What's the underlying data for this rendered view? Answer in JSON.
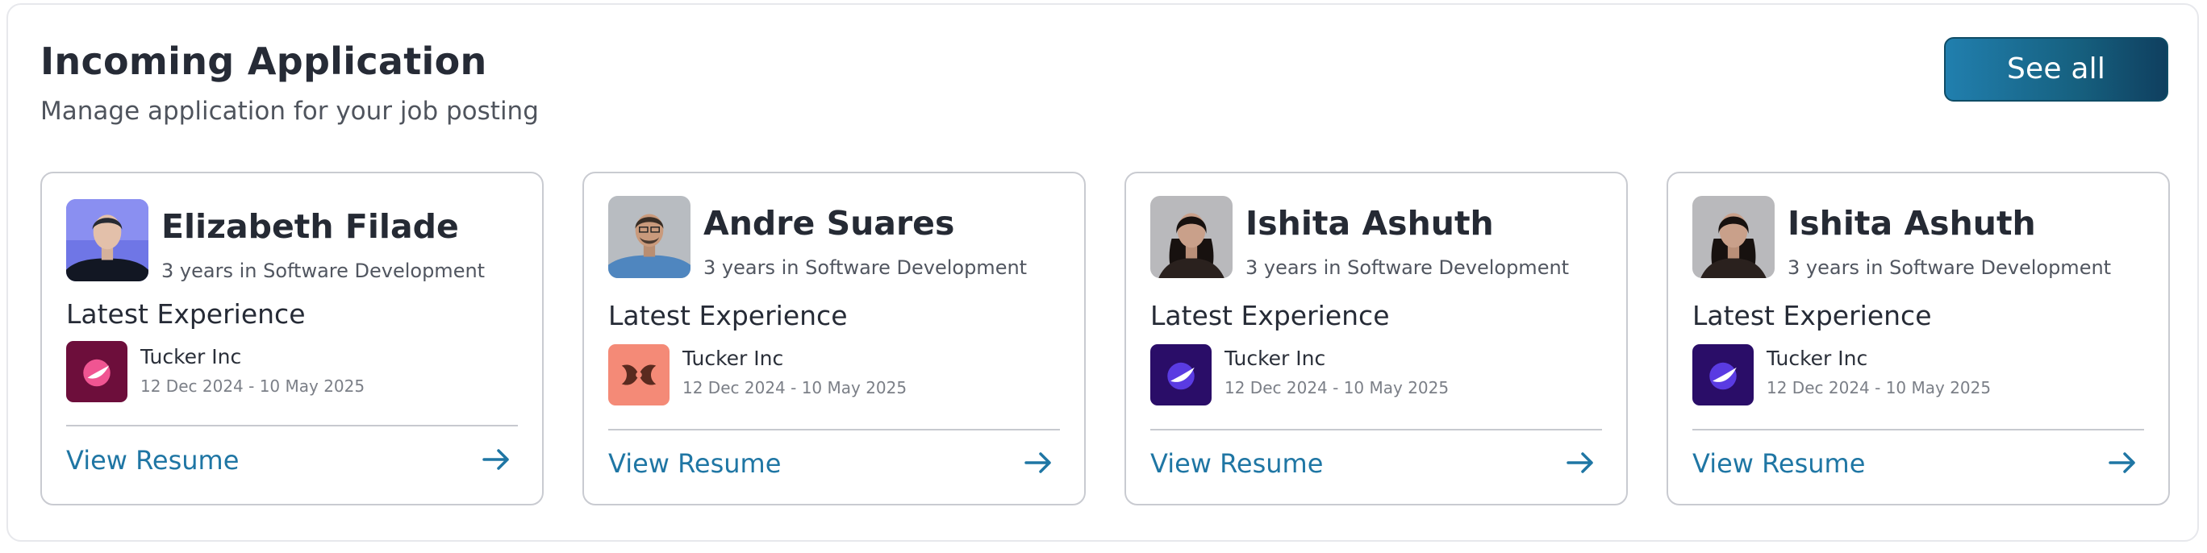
{
  "header": {
    "title": "Incoming Application",
    "subtitle": "Manage application for your job posting",
    "see_all_label": "See all"
  },
  "cards": [
    {
      "name": "Elizabeth Filade",
      "experience": "3 years in Software Development",
      "latest_label": "Latest Experience",
      "company": "Tucker Inc",
      "dates": "12 Dec 2024 - 10 May 2025",
      "action": "View Resume",
      "avatar_icon": "avatar-woman-blue-bg",
      "company_icon": "tucker-logo-pink"
    },
    {
      "name": "Andre Suares",
      "experience": "3 years in Software Development",
      "latest_label": "Latest Experience",
      "company": "Tucker Inc",
      "dates": "12 Dec 2024 - 10 May 2025",
      "action": "View Resume",
      "avatar_icon": "avatar-man-grey-bg",
      "company_icon": "tucker-logo-coral"
    },
    {
      "name": "Ishita Ashuth",
      "experience": "3 years in Software Development",
      "latest_label": "Latest Experience",
      "company": "Tucker Inc",
      "dates": "12 Dec 2024 - 10 May 2025",
      "action": "View Resume",
      "avatar_icon": "avatar-woman-grey-bg",
      "company_icon": "tucker-logo-indigo"
    },
    {
      "name": "Ishita Ashuth",
      "experience": "3 years in Software Development",
      "latest_label": "Latest Experience",
      "company": "Tucker Inc",
      "dates": "12 Dec 2024 - 10 May 2025",
      "action": "View Resume",
      "avatar_icon": "avatar-woman-grey-bg",
      "company_icon": "tucker-logo-indigo"
    }
  ],
  "colors": {
    "accent": "#1f76a4",
    "button_gradient_start": "#217fae",
    "button_gradient_end": "#0f3f5f",
    "card_border": "#c9cbd1"
  }
}
